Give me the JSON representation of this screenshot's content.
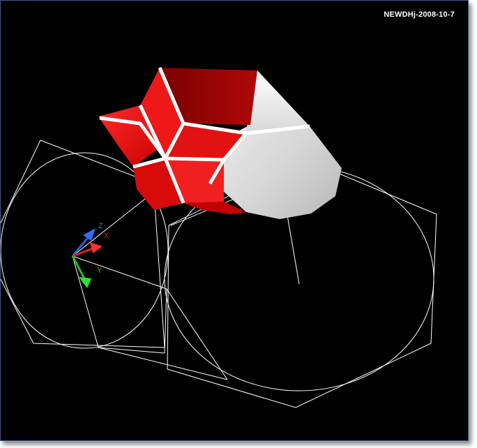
{
  "viewport": {
    "watermark": "NEWDHj-2008-10-7",
    "background_color": "#000000",
    "wireframe_color": "#ffffff",
    "solid_color": "#e01414",
    "solid_dark_color": "#8e0000",
    "solid_white_color": "#e6e6e6"
  },
  "ucs_icon": {
    "x_label": "X",
    "y_label": "Y",
    "z_label": "Z",
    "x_color": "#e02020",
    "y_color": "#20c020",
    "z_color": "#2060e0"
  }
}
